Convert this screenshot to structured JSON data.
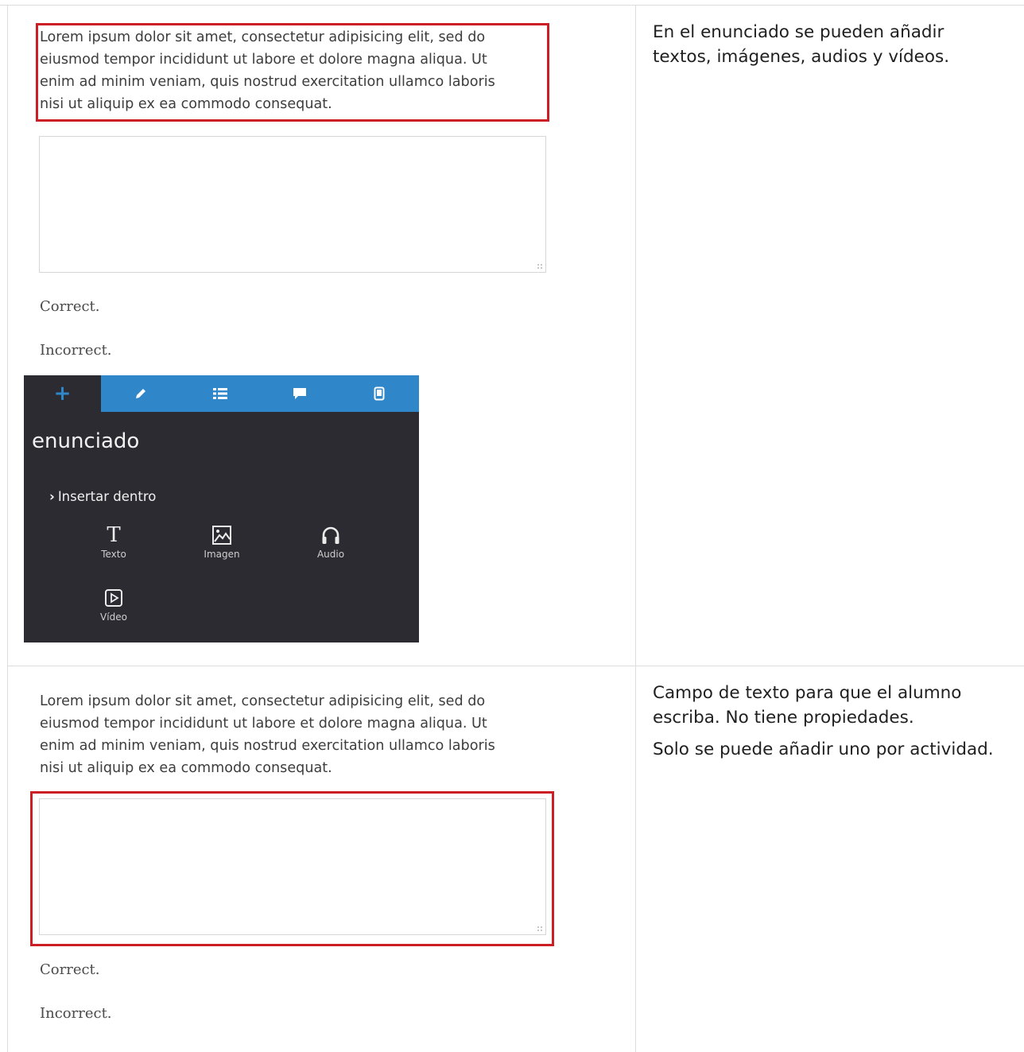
{
  "row1": {
    "prompt_lines": [
      "Lorem ipsum dolor sit amet, consectetur adipisicing elit, sed do",
      "eiusmod tempor incididunt ut labore et dolore magna aliqua. Ut",
      "enim ad minim veniam, quis nostrud exercitation ullamco laboris",
      "nisi ut aliquip ex ea commodo consequat."
    ],
    "feedback_correct": "Correct.",
    "feedback_incorrect": "Incorrect.",
    "description": [
      "En el enunciado se pueden añadir textos, imágenes, audios y vídeos."
    ]
  },
  "editor_panel": {
    "tabs": [
      {
        "icon": "plus-icon",
        "label": "+"
      },
      {
        "icon": "pencil-icon"
      },
      {
        "icon": "list-icon"
      },
      {
        "icon": "comment-icon"
      },
      {
        "icon": "mobile-icon"
      }
    ],
    "title": "enunciado",
    "insert_label": "Insertar dentro",
    "tools": [
      {
        "icon": "text-icon",
        "glyph": "T",
        "label": "Texto"
      },
      {
        "icon": "image-icon",
        "label": "Imagen"
      },
      {
        "icon": "headphones-icon",
        "label": "Audio"
      },
      {
        "icon": "video-icon",
        "label": "Vídeo"
      }
    ],
    "colors": {
      "tab_bar": "#2f86c8",
      "panel_bg": "#2b2b31"
    }
  },
  "row2": {
    "prompt_lines": [
      "Lorem ipsum dolor sit amet, consectetur adipisicing elit, sed do",
      "eiusmod tempor incididunt ut labore et dolore magna aliqua. Ut",
      "enim ad minim veniam, quis nostrud exercitation ullamco laboris",
      "nisi ut aliquip ex ea commodo consequat."
    ],
    "feedback_correct": "Correct.",
    "feedback_incorrect": "Incorrect.",
    "description": [
      "Campo de texto para que el alumno escriba. No tiene propiedades.",
      "Solo se puede añadir uno por actividad."
    ]
  },
  "highlight_color": "#cc1e25"
}
